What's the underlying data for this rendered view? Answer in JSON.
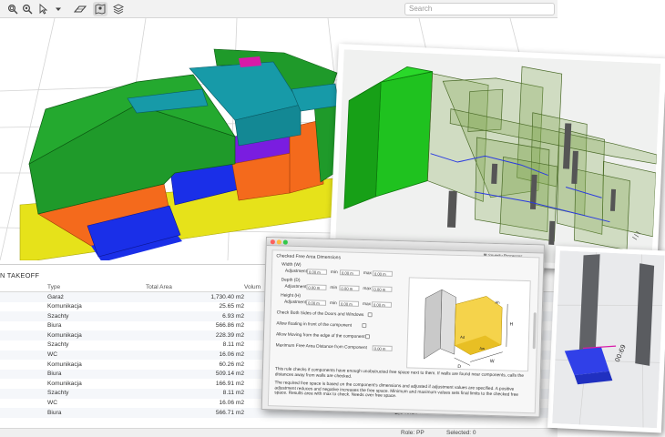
{
  "toolbar": {
    "search_placeholder": "Search",
    "icons": [
      "zoom-window-icon",
      "zoom-icon",
      "select-dropdown-icon",
      "dropdown-caret-icon",
      "plane-view-icon",
      "map-pin-view-icon",
      "layers-icon"
    ]
  },
  "takeoff": {
    "title": "N TAKEOFF",
    "columns": {
      "type": "Type",
      "area": "Total Area",
      "volume": "Volum"
    },
    "rows": [
      {
        "type": "Garaż",
        "area": "1,730.40 m2",
        "volume": ""
      },
      {
        "type": "Komunikacja",
        "area": "25.65 m2",
        "volume": ""
      },
      {
        "type": "Szachty",
        "area": "6.93 m2",
        "volume": ""
      },
      {
        "type": "Biura",
        "area": "566.86 m2",
        "volume": ""
      },
      {
        "type": "Komunikacja",
        "area": "228.39 m2",
        "volume": ""
      },
      {
        "type": "Szachty",
        "area": "8.11 m2",
        "volume": ""
      },
      {
        "type": "WC",
        "area": "16.06 m2",
        "volume": ""
      },
      {
        "type": "Komunikacja",
        "area": "60.26 m2",
        "volume": ""
      },
      {
        "type": "Biura",
        "area": "509.14 m2",
        "volume": ""
      },
      {
        "type": "Komunikacja",
        "area": "166.91 m2",
        "volume": ""
      },
      {
        "type": "Szachty",
        "area": "8.11 m2",
        "volume": ""
      },
      {
        "type": "WC",
        "area": "16.06 m2",
        "volume": ""
      },
      {
        "type": "Biura",
        "area": "566.71 m2",
        "volume": "2,040.15 m3"
      }
    ]
  },
  "status": {
    "role": "Role: PP",
    "selected": "Selected: 0"
  },
  "dialog": {
    "title": "Checked Free Area Dimensions",
    "severity": "Severity Processes",
    "width_label": "Width (W)",
    "depth_label": "Depth (D)",
    "height_label": "Height (H)",
    "adjustment_label": "Adjustment",
    "min_label": "min",
    "max_label": "max",
    "width_values": [
      "0.00 m",
      "0.00 m",
      "0.00 m"
    ],
    "depth_values": [
      "0.00 m",
      "0.00 m",
      "0.00 m"
    ],
    "height_values": [
      "0.00 m",
      "0.00 m",
      "0.00 m"
    ],
    "check_both_sides": "Check Both Sides of the Doors and Windows",
    "allow_floating": "Allow floating in front of the component",
    "allow_moving": "Allow Moving from the edge of the component",
    "max_free_area": "Maximum Free Area Distance from Component",
    "max_free_value": "0.00 m",
    "para1": "This rule checks if components have enough unobstructed free space next to them. If walls are found near components, calls the distances away from walls are checked.",
    "para2": "The required free space is based on the component's dimensions and adjusted if adjustment values are specified. A positive adjustment reduces and negative increases the free space. Minimum and maximum values sets final limits to the checked free space. Results area with max to check. Needs over free space.",
    "diagram_labels": {
      "h": "H",
      "w": "W",
      "d": "D",
      "aw": "Aw",
      "ad": "Ad",
      "ah": "Ah"
    }
  },
  "colors": {
    "green": "#1f9a2a",
    "teal": "#179aa8",
    "yellow": "#e6e21a",
    "orange": "#f46a1c",
    "blue": "#1a2fe8",
    "purple": "#7a1de0",
    "magenta": "#d81aa8"
  }
}
